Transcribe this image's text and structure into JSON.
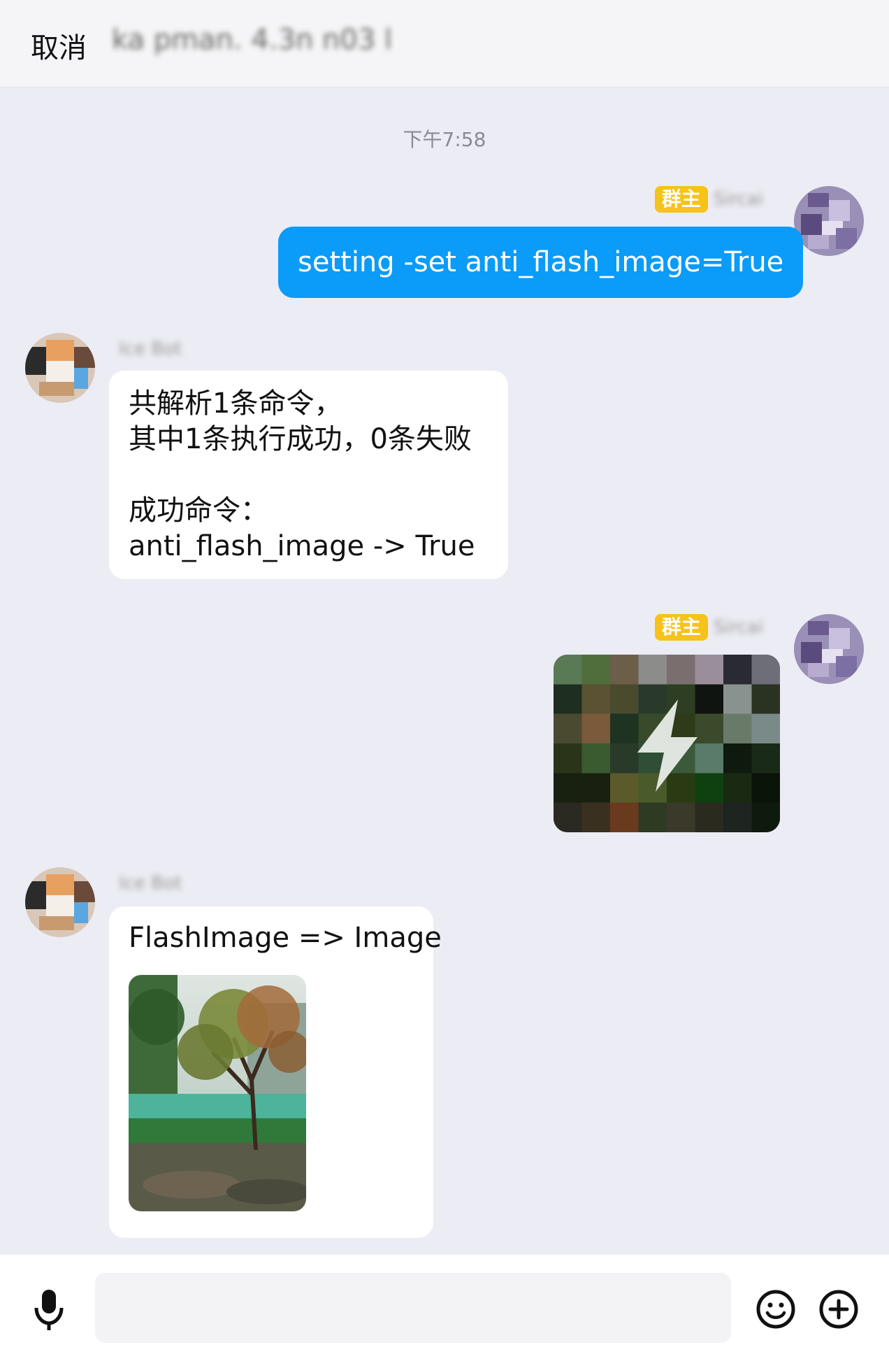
{
  "header": {
    "cancel_label": "取消",
    "title": "ka pman. 4.3n n03 l"
  },
  "chat": {
    "timestamp": "下午7:58",
    "messages": [
      {
        "direction": "out",
        "badge": "群主",
        "sender": "Sircai",
        "text": "setting -set anti_flash_image=True"
      },
      {
        "direction": "in",
        "sender": "Ice Bot",
        "lines": "共解析1条命令，\n其中1条执行成功，0条失败\n\n成功命令：\nanti_flash_image -> True"
      },
      {
        "direction": "out",
        "badge": "群主",
        "sender": "Sircai",
        "content": "flash-image",
        "icon": "lightning-bolt-icon"
      },
      {
        "direction": "in",
        "sender": "Ice Bot",
        "text": "FlashImage => Image",
        "image": "autumn-tree-photo"
      }
    ]
  },
  "footer": {
    "icons": [
      "microphone-icon",
      "emoji-icon",
      "plus-icon"
    ]
  },
  "colors": {
    "bubble_out": "#0b9bf8",
    "badge": "#f7c21a",
    "background": "#ececf4"
  }
}
